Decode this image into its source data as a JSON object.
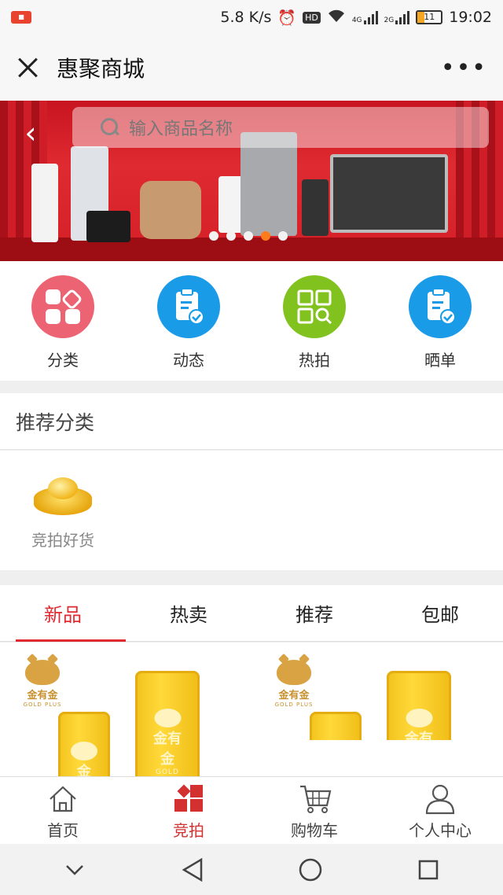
{
  "status_bar": {
    "speed": "5.8 K/s",
    "hd": "HD",
    "net4g": "4G",
    "net2g": "2G",
    "battery": "11",
    "time": "19:02"
  },
  "title_bar": {
    "title": "惠聚商城",
    "more": "•••"
  },
  "banner": {
    "search_placeholder": "输入商品名称"
  },
  "quick_nav": [
    {
      "label": "分类",
      "icon": "category-icon",
      "color": "#ec6473"
    },
    {
      "label": "动态",
      "icon": "clipboard-check-icon",
      "color": "#1a9be8"
    },
    {
      "label": "热拍",
      "icon": "grid-search-icon",
      "color": "#82c21e"
    },
    {
      "label": "晒单",
      "icon": "clipboard-check-icon",
      "color": "#1a9be8"
    }
  ],
  "recommended": {
    "heading": "推荐分类",
    "items": [
      {
        "label": "竞拍好货",
        "icon": "gold-ingot-icon"
      }
    ]
  },
  "tabs": [
    {
      "label": "新品",
      "active": true
    },
    {
      "label": "热卖",
      "active": false
    },
    {
      "label": "推荐",
      "active": false
    },
    {
      "label": "包邮",
      "active": false
    }
  ],
  "products": {
    "brand_name": "金有金",
    "brand_en": "GOLD PLUS"
  },
  "bottom_nav": [
    {
      "label": "首页",
      "icon": "home-icon",
      "active": false
    },
    {
      "label": "竞拍",
      "icon": "auction-icon",
      "active": true
    },
    {
      "label": "购物车",
      "icon": "cart-icon",
      "active": false
    },
    {
      "label": "个人中心",
      "icon": "user-icon",
      "active": false
    }
  ],
  "colors": {
    "accent": "#e02a31",
    "banner_red": "#d41f28"
  }
}
